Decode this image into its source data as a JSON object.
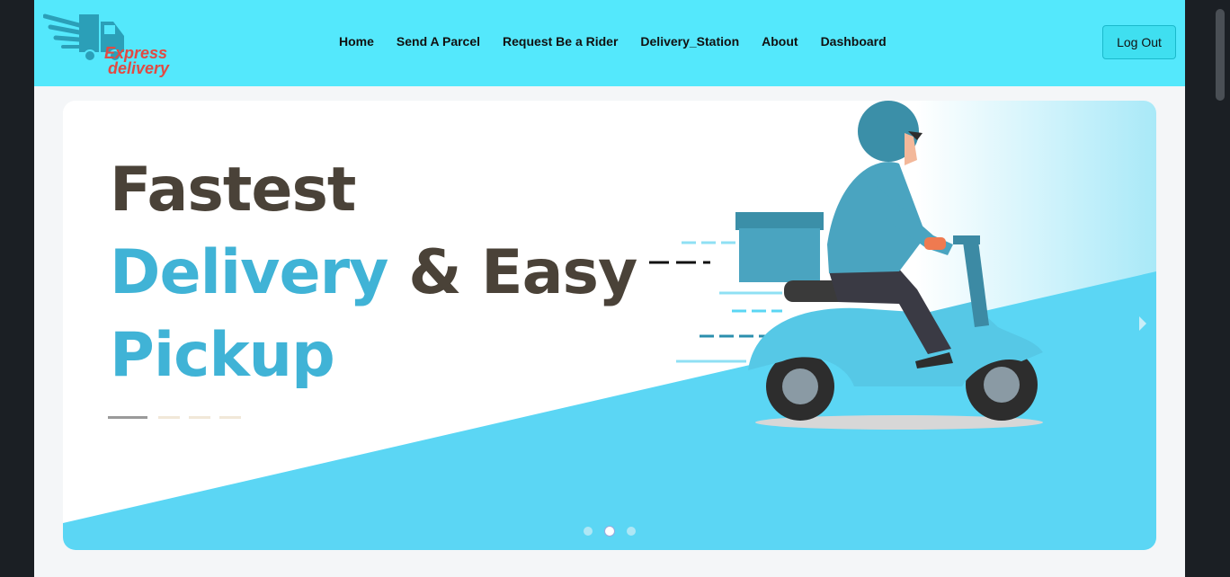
{
  "brand": {
    "line1": "Express",
    "line2": "delivery"
  },
  "nav": {
    "links": [
      "Home",
      "Send A Parcel",
      "Request Be a Rider",
      "Delivery_Station",
      "About",
      "Dashboard"
    ],
    "logout_label": "Log Out"
  },
  "hero": {
    "line1": "Fastest",
    "line2_blue": "Delivery",
    "line2_dark": "& Easy",
    "line3": "Pickup",
    "slides": 3,
    "active_slide": 2
  },
  "colors": {
    "navbar": "#54e8fc",
    "accent_blue": "#40b3d6",
    "dark_text": "#4a4238",
    "logo_red": "#e14a43"
  }
}
